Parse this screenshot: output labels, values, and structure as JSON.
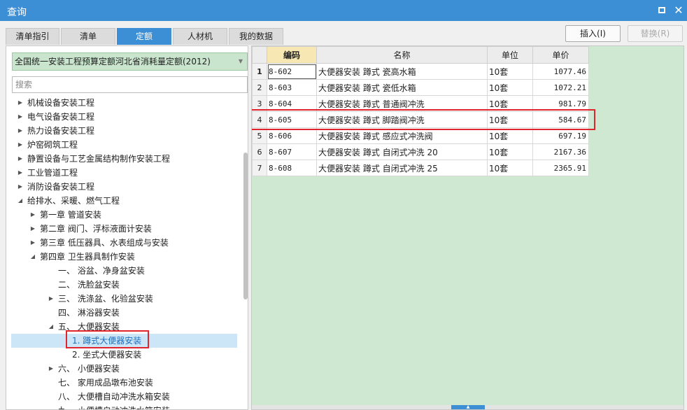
{
  "window": {
    "title": "查询"
  },
  "tabs": [
    "清单指引",
    "清单",
    "定额",
    "人材机",
    "我的数据"
  ],
  "active_tab": 2,
  "buttons": {
    "insert": "插入(I)",
    "replace": "替换(R)"
  },
  "quota_library": "全国统一安装工程预算定额河北省消耗量定额(2012)",
  "search": {
    "placeholder": "搜索"
  },
  "tree": [
    {
      "label": "机械设备安装工程",
      "level": 0,
      "expander": "collapsed"
    },
    {
      "label": "电气设备安装工程",
      "level": 0,
      "expander": "collapsed"
    },
    {
      "label": "热力设备安装工程",
      "level": 0,
      "expander": "collapsed"
    },
    {
      "label": "炉窑砌筑工程",
      "level": 0,
      "expander": "collapsed"
    },
    {
      "label": "静置设备与工艺金属结构制作安装工程",
      "level": 0,
      "expander": "collapsed"
    },
    {
      "label": "工业管道工程",
      "level": 0,
      "expander": "collapsed"
    },
    {
      "label": "消防设备安装工程",
      "level": 0,
      "expander": "collapsed"
    },
    {
      "label": "给排水、采暖、燃气工程",
      "level": 0,
      "expander": "expanded"
    },
    {
      "label": "第一章 管道安装",
      "level": 1,
      "expander": "collapsed"
    },
    {
      "label": "第二章 阀门、浮标液面计安装",
      "level": 1,
      "expander": "collapsed"
    },
    {
      "label": "第三章 低压器具、水表组成与安装",
      "level": 1,
      "expander": "collapsed"
    },
    {
      "label": "第四章 卫生器具制作安装",
      "level": 1,
      "expander": "expanded"
    },
    {
      "label": "一、 浴盆、净身盆安装",
      "level": 2,
      "expander": "none"
    },
    {
      "label": "二、 洗脸盆安装",
      "level": 2,
      "expander": "none"
    },
    {
      "label": "三、 洗涤盆、化验盆安装",
      "level": 2,
      "expander": "collapsed"
    },
    {
      "label": "四、 淋浴器安装",
      "level": 2,
      "expander": "none"
    },
    {
      "label": "五、 大便器安装",
      "level": 2,
      "expander": "expanded"
    },
    {
      "label": "1. 蹲式大便器安装",
      "level": 3,
      "expander": "none",
      "selected": true
    },
    {
      "label": "2. 坐式大便器安装",
      "level": 3,
      "expander": "none"
    },
    {
      "label": "六、 小便器安装",
      "level": 2,
      "expander": "collapsed"
    },
    {
      "label": "七、 家用成品墩布池安装",
      "level": 2,
      "expander": "none"
    },
    {
      "label": "八、 大便槽自动冲洗水箱安装",
      "level": 2,
      "expander": "none"
    },
    {
      "label": "九、 小便槽自动冲洗水箱安装",
      "level": 2,
      "expander": "none"
    }
  ],
  "grid": {
    "columns": [
      "编码",
      "名称",
      "单位",
      "单价"
    ],
    "rows": [
      {
        "n": "1",
        "code": "8-602",
        "name": "大便器安装 蹲式 瓷高水箱",
        "unit": "10套",
        "price": "1077.46"
      },
      {
        "n": "2",
        "code": "8-603",
        "name": "大便器安装 蹲式 瓷低水箱",
        "unit": "10套",
        "price": "1072.21"
      },
      {
        "n": "3",
        "code": "8-604",
        "name": "大便器安装 蹲式 普通阀冲洗",
        "unit": "10套",
        "price": "981.79"
      },
      {
        "n": "4",
        "code": "8-605",
        "name": "大便器安装 蹲式 脚踏阀冲洗",
        "unit": "10套",
        "price": "584.67"
      },
      {
        "n": "5",
        "code": "8-606",
        "name": "大便器安装 蹲式 感应式冲洗阀",
        "unit": "10套",
        "price": "697.19"
      },
      {
        "n": "6",
        "code": "8-607",
        "name": "大便器安装 蹲式 自闭式冲洗 20",
        "unit": "10套",
        "price": "2167.36"
      },
      {
        "n": "7",
        "code": "8-608",
        "name": "大便器安装 蹲式 自闭式冲洗 25",
        "unit": "10套",
        "price": "2365.91"
      }
    ],
    "current_row": 0,
    "highlighted_row": 3
  },
  "colors": {
    "accent": "#3d8fd5",
    "highlight": "#e0262c",
    "grid_background": "#cfe8d2",
    "selector_background": "#c9e5cd"
  }
}
